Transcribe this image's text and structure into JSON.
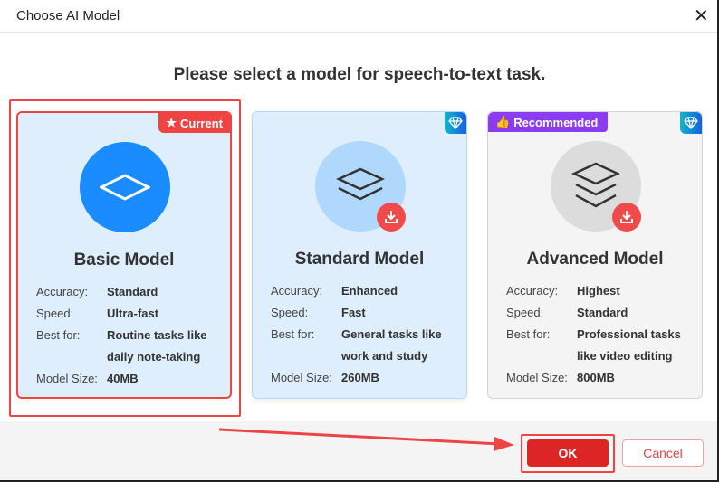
{
  "window": {
    "title": "Choose AI Model",
    "close_label": "✕"
  },
  "heading": "Please select a model for speech-to-text task.",
  "labels": {
    "accuracy": "Accuracy:",
    "speed": "Speed:",
    "best_for": "Best for:",
    "size": "Model Size:"
  },
  "models": [
    {
      "name": "Basic Model",
      "badge": "Current",
      "accuracy": "Standard",
      "speed": "Ultra-fast",
      "best_for": "Routine tasks like daily note-taking",
      "size": "40MB"
    },
    {
      "name": "Standard Model",
      "accuracy": "Enhanced",
      "speed": "Fast",
      "best_for": "General tasks like work and study",
      "size": "260MB"
    },
    {
      "name": "Advanced Model",
      "badge": "Recommended",
      "accuracy": "Highest",
      "speed": "Standard",
      "best_for": "Professional tasks like video editing",
      "size": "800MB"
    }
  ],
  "buttons": {
    "ok": "OK",
    "cancel": "Cancel"
  },
  "colors": {
    "accent": "#1a8cff",
    "red": "#ef4444",
    "purple": "#8b3cf0"
  }
}
